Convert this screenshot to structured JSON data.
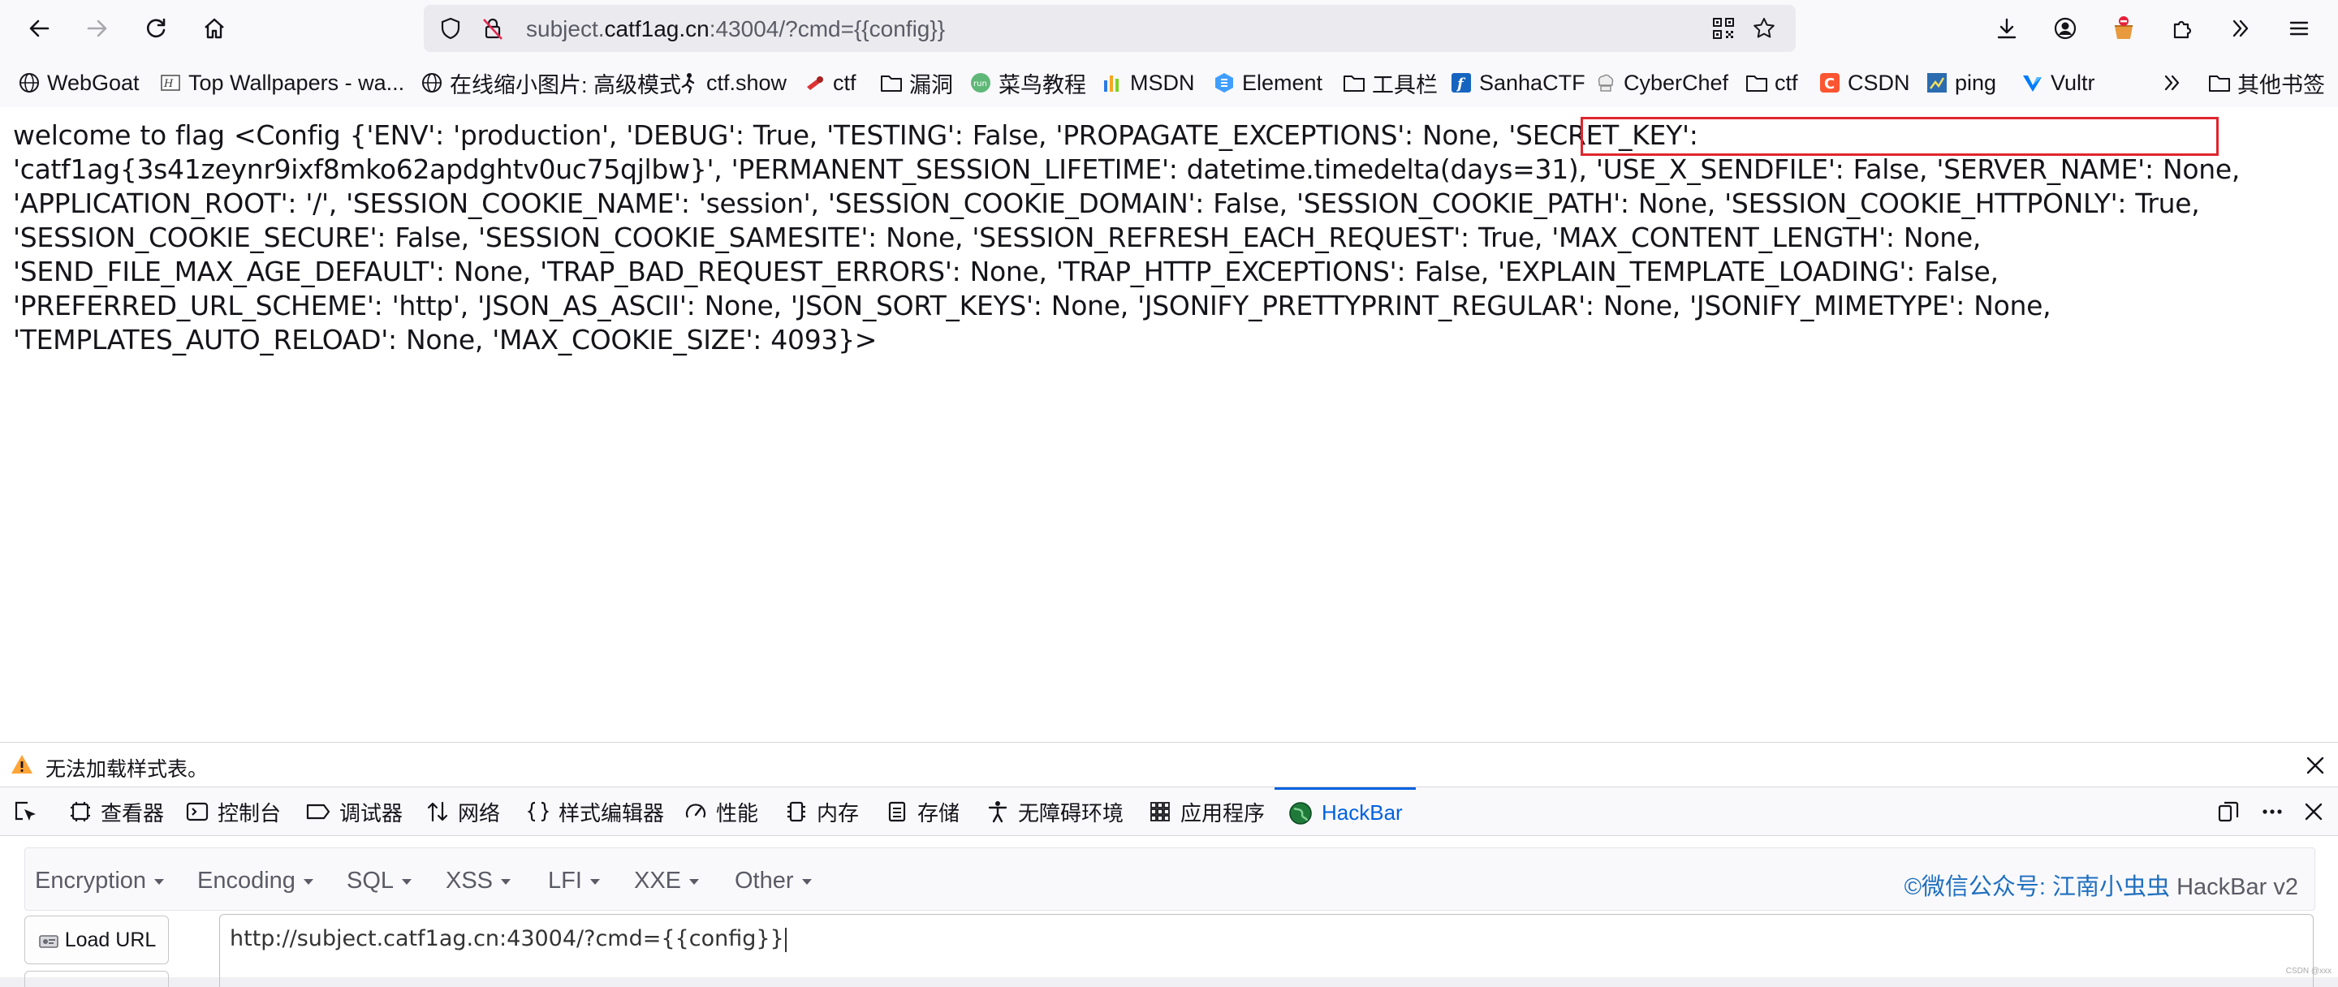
{
  "browser": {
    "url_prefix": "subject.",
    "url_host": "catf1ag.cn",
    "url_rest": ":43004/?cmd={{config}}"
  },
  "bookmarks": [
    {
      "label": "WebGoat",
      "icon": "globe-icon"
    },
    {
      "label": "Top Wallpapers - wa...",
      "icon": "wallpaper-icon"
    },
    {
      "label": "在线缩小图片: 高级模式",
      "icon": "globe-icon"
    },
    {
      "label": "ctf.show",
      "icon": "runner-icon"
    },
    {
      "label": "ctf",
      "icon": "ctf-site-icon"
    },
    {
      "label": "漏洞",
      "icon": "folder-icon"
    },
    {
      "label": "菜鸟教程",
      "icon": "runoob-icon"
    },
    {
      "label": "MSDN",
      "icon": "msdn-icon"
    },
    {
      "label": "Element",
      "icon": "element-icon"
    },
    {
      "label": "工具栏",
      "icon": "folder-icon"
    },
    {
      "label": "SanhaCTF",
      "icon": "sanha-icon"
    },
    {
      "label": "CyberChef",
      "icon": "cyberchef-icon"
    },
    {
      "label": "ctf",
      "icon": "folder-icon"
    },
    {
      "label": "CSDN",
      "icon": "csdn-icon"
    },
    {
      "label": "ping",
      "icon": "ping-icon"
    },
    {
      "label": "Vultr",
      "icon": "vultr-icon"
    }
  ],
  "bookmarks_other": "其他书签",
  "page": {
    "line1_before": "welcome to flag <Config {'ENV': 'production', 'DEBUG': True, 'TESTING': False, 'PROPAGATE_EXCEPTIONS': None, 'SECRET_KEY': '",
    "secret_key": "catf1ag{3s41zeynr9ixf8mko62apdghtv0uc75qjlbw}",
    "rest": "', 'PERMANENT_SESSION_LIFETIME': datetime.timedelta(days=31), 'USE_X_SENDFILE': False, 'SERVER_NAME': None, 'APPLICATION_ROOT': '/', 'SESSION_COOKIE_NAME': 'session', 'SESSION_COOKIE_DOMAIN': False, 'SESSION_COOKIE_PATH': None, 'SESSION_COOKIE_HTTPONLY': True, 'SESSION_COOKIE_SECURE': False, 'SESSION_COOKIE_SAMESITE': None, 'SESSION_REFRESH_EACH_REQUEST': True, 'MAX_CONTENT_LENGTH': None, 'SEND_FILE_MAX_AGE_DEFAULT': None, 'TRAP_BAD_REQUEST_ERRORS': None, 'TRAP_HTTP_EXCEPTIONS': False, 'EXPLAIN_TEMPLATE_LOADING': False, 'PREFERRED_URL_SCHEME': 'http', 'JSON_AS_ASCII': None, 'JSON_SORT_KEYS': None, 'JSONIFY_PRETTYPRINT_REGULAR': None, 'JSONIFY_MIMETYPE': None, 'TEMPLATES_AUTO_RELOAD': None, 'MAX_COOKIE_SIZE': 4093}>",
    "highlight_color": "#e0252d"
  },
  "warning": {
    "text": "无法加载样式表。"
  },
  "devtools": {
    "tabs": [
      "查看器",
      "控制台",
      "调试器",
      "网络",
      "样式编辑器",
      "性能",
      "内存",
      "存储",
      "无障碍环境",
      "应用程序",
      "HackBar"
    ],
    "active_tab": "HackBar"
  },
  "hackbar": {
    "menus": [
      "Encryption",
      "Encoding",
      "SQL",
      "XSS",
      "LFI",
      "XXE",
      "Other"
    ],
    "credit": "©微信公众号: 江南小虫虫",
    "version": "HackBar v2",
    "load_url": "Load URL",
    "url_value": "http://subject.catf1ag.cn:43004/?cmd={{config}}"
  },
  "watermark": "CSDN @xxx"
}
